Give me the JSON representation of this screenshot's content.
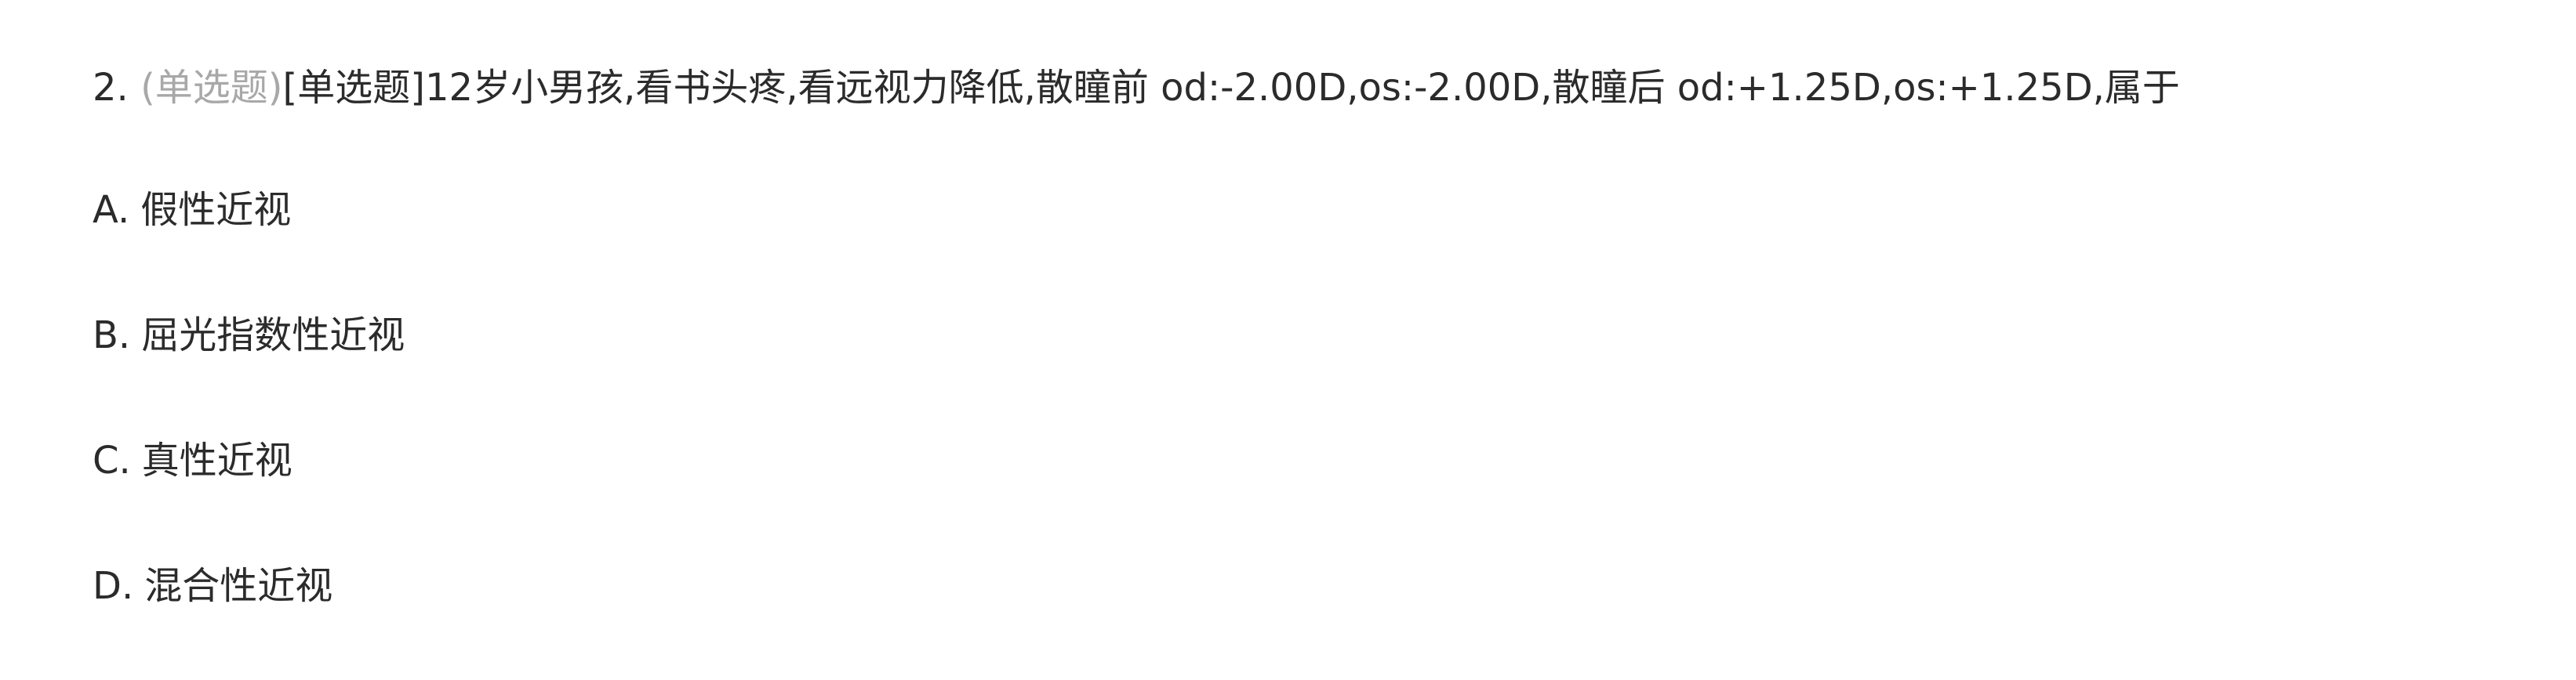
{
  "question": {
    "number": "2.",
    "type_muted": "(单选题)",
    "type_bracket": "[单选题]",
    "stem": "12岁小男孩,看书头疼,看远视力降低,散瞳前 od:-2.00D,os:-2.00D,散瞳后 od:+1.25D,os:+1.25D,属于"
  },
  "options": [
    {
      "letter": "A.",
      "text": "假性近视"
    },
    {
      "letter": "B.",
      "text": "屈光指数性近视"
    },
    {
      "letter": "C.",
      "text": "真性近视"
    },
    {
      "letter": "D.",
      "text": "混合性近视"
    }
  ]
}
